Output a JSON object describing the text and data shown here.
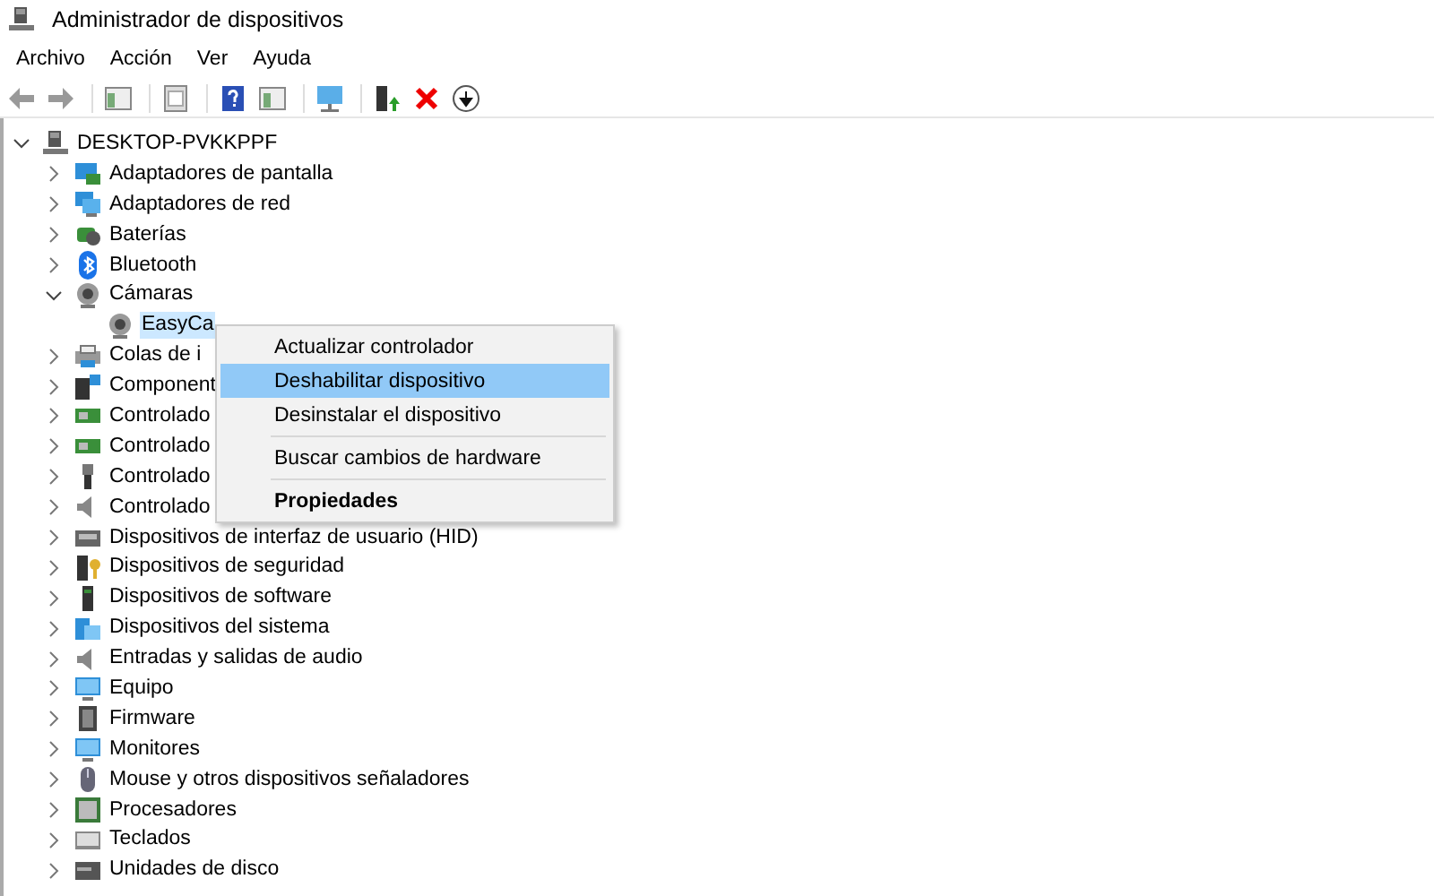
{
  "window": {
    "title": "Administrador de dispositivos"
  },
  "menu_bar": [
    "Archivo",
    "Acción",
    "Ver",
    "Ayuda"
  ],
  "tree": {
    "label": "DESKTOP-PVKKPPF",
    "expanded": true,
    "selected": false,
    "children": [
      {
        "label": "Adaptadores de pantalla",
        "expanded": false,
        "selected": false
      },
      {
        "label": "Adaptadores de red",
        "expanded": false,
        "selected": false
      },
      {
        "label": "Baterías",
        "expanded": false,
        "selected": false
      },
      {
        "label": "Bluetooth",
        "expanded": false,
        "selected": false
      },
      {
        "label": "Cámaras",
        "expanded": true,
        "selected": false,
        "children": [
          {
            "label": "EasyCa",
            "selected": true
          }
        ]
      },
      {
        "label": "Colas de i",
        "expanded": false,
        "selected": false
      },
      {
        "label": "Component",
        "expanded": false,
        "selected": false
      },
      {
        "label": "Controlado",
        "expanded": false,
        "selected": false
      },
      {
        "label": "Controlado",
        "expanded": false,
        "selected": false
      },
      {
        "label": "Controlado",
        "expanded": false,
        "selected": false
      },
      {
        "label": "Controlado",
        "expanded": false,
        "selected": false
      },
      {
        "label": "Dispositivos de interfaz de usuario (HID)",
        "expanded": false,
        "selected": false
      },
      {
        "label": "Dispositivos de seguridad",
        "expanded": false,
        "selected": false
      },
      {
        "label": "Dispositivos de software",
        "expanded": false,
        "selected": false
      },
      {
        "label": "Dispositivos del sistema",
        "expanded": false,
        "selected": false
      },
      {
        "label": "Entradas y salidas de audio",
        "expanded": false,
        "selected": false
      },
      {
        "label": "Equipo",
        "expanded": false,
        "selected": false
      },
      {
        "label": "Firmware",
        "expanded": false,
        "selected": false
      },
      {
        "label": "Monitores",
        "expanded": false,
        "selected": false
      },
      {
        "label": "Mouse y otros dispositivos señaladores",
        "expanded": false,
        "selected": false
      },
      {
        "label": "Procesadores",
        "expanded": false,
        "selected": false
      },
      {
        "label": "Teclados",
        "expanded": false,
        "selected": false
      },
      {
        "label": "Unidades de disco",
        "expanded": false,
        "selected": false
      }
    ]
  },
  "context_menu": [
    {
      "kind": "item",
      "label": "Actualizar controlador",
      "selected": false,
      "default": false
    },
    {
      "kind": "item",
      "label": "Deshabilitar dispositivo",
      "selected": true,
      "default": false
    },
    {
      "kind": "item",
      "label": "Desinstalar el dispositivo",
      "selected": false,
      "default": false
    },
    {
      "kind": "separator"
    },
    {
      "kind": "item",
      "label": "Buscar cambios de hardware",
      "selected": false,
      "default": false
    },
    {
      "kind": "separator"
    },
    {
      "kind": "item",
      "label": "Propiedades",
      "selected": false,
      "default": true
    }
  ]
}
